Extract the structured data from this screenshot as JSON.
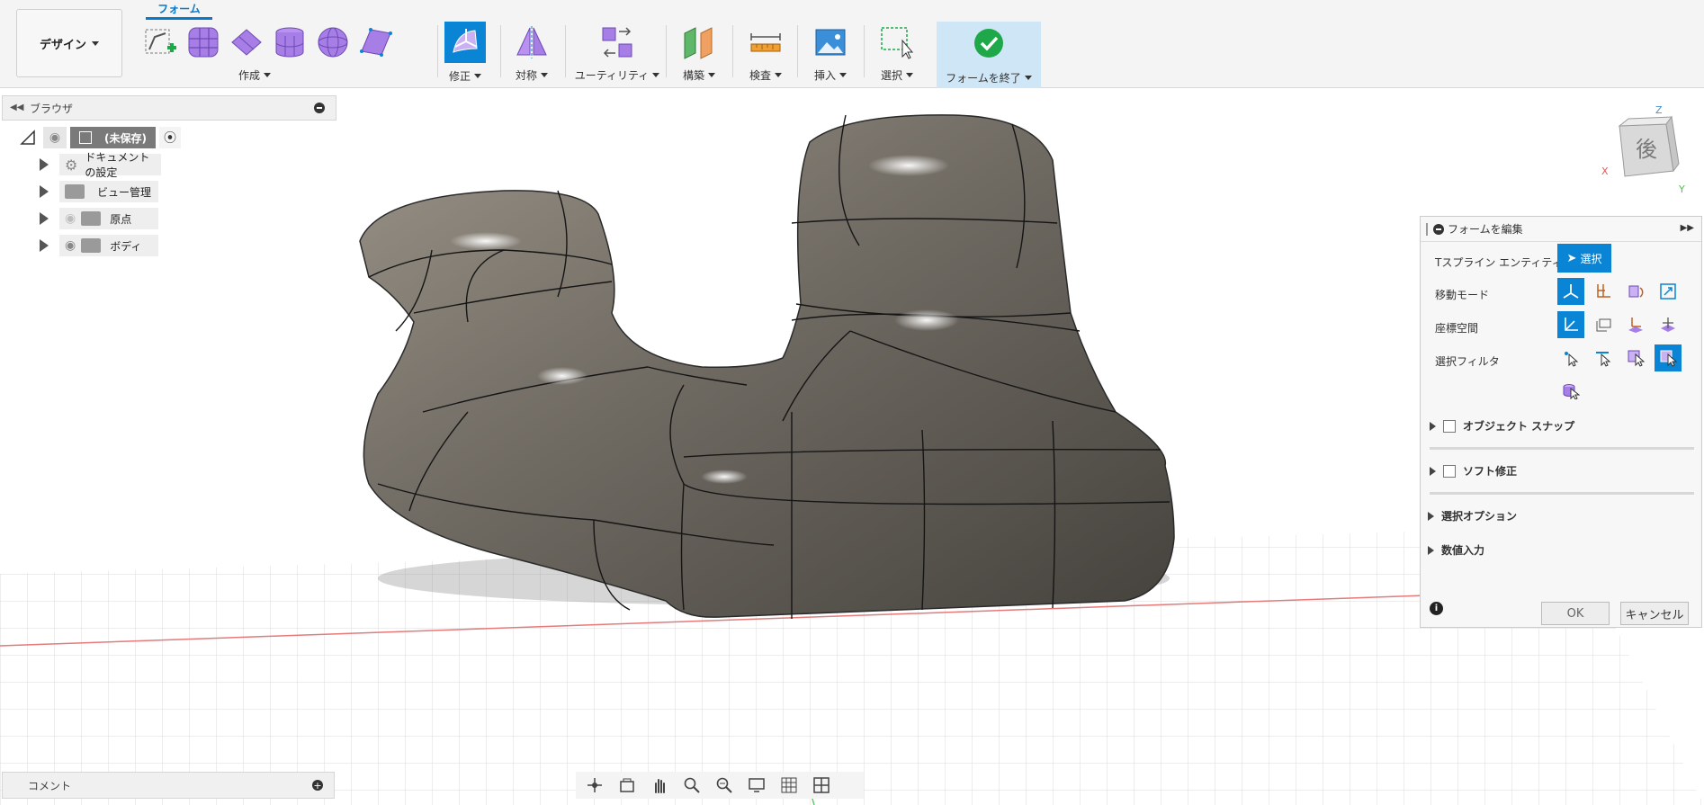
{
  "workspace": {
    "label": "デザイン"
  },
  "toolbar": {
    "active_tab": "フォーム",
    "groups": {
      "create": "作成",
      "modify": "修正",
      "symmetry": "対称",
      "utilities": "ユーティリティ",
      "construct": "構築",
      "inspect": "検査",
      "insert": "挿入",
      "select": "選択",
      "finish": "フォームを終了"
    }
  },
  "browser": {
    "title": "ブラウザ",
    "root": "(未保存)",
    "items": [
      {
        "label": "ドキュメントの設定",
        "icon": "gear-icon"
      },
      {
        "label": "ビュー管理",
        "icon": "folder-icon"
      },
      {
        "label": "原点",
        "icon": "folder-icon"
      },
      {
        "label": "ボディ",
        "icon": "folder-icon"
      }
    ]
  },
  "viewcube": {
    "face": "後",
    "axis_x": "X",
    "axis_y": "Y",
    "axis_z": "Z"
  },
  "edit_form": {
    "title": "フォームを編集",
    "tspline_label": "Tスプライン エンティティ",
    "tspline_button": "選択",
    "move_mode_label": "移動モード",
    "coord_space_label": "座標空間",
    "select_filter_label": "選択フィルタ",
    "object_snap": "オブジェクト スナップ",
    "soft_modify": "ソフト修正",
    "select_options": "選択オプション",
    "numeric_input": "数値入力",
    "ok": "OK",
    "cancel": "キャンセル"
  },
  "comments": {
    "label": "コメント"
  },
  "colors": {
    "accent": "#0a84d4",
    "finish_bg": "#cfe6f6",
    "create_purple": "#9a6fe0"
  }
}
